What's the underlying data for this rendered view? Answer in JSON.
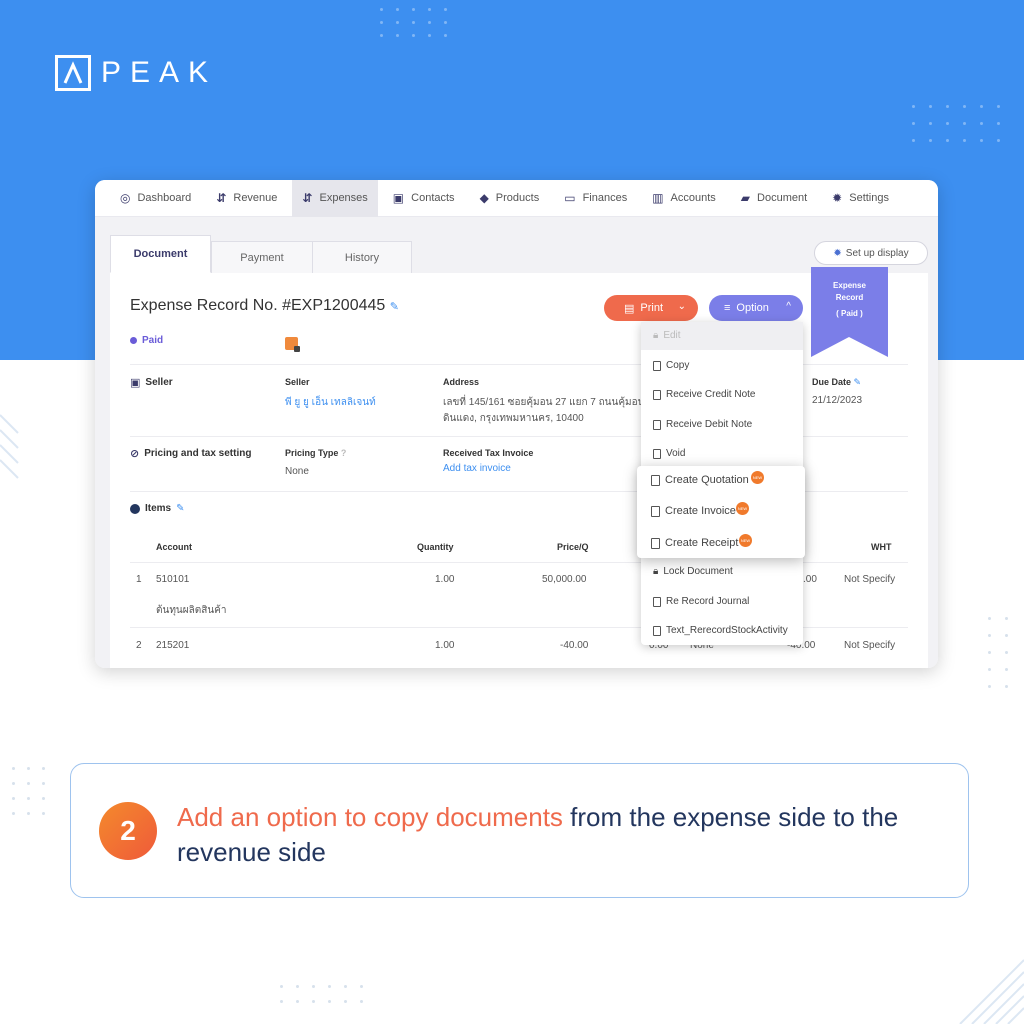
{
  "brand": {
    "name": "PEAK",
    "hero_color": "#3d8ff0",
    "accent_orange": "#ef6a4c",
    "accent_purple": "#7b7ee8"
  },
  "nav": {
    "items": [
      {
        "label": "Dashboard",
        "icon": "dashboard-icon"
      },
      {
        "label": "Revenue",
        "icon": "revenue-icon"
      },
      {
        "label": "Expenses",
        "icon": "expenses-icon",
        "active": true
      },
      {
        "label": "Contacts",
        "icon": "contacts-icon"
      },
      {
        "label": "Products",
        "icon": "products-icon"
      },
      {
        "label": "Finances",
        "icon": "finances-icon"
      },
      {
        "label": "Accounts",
        "icon": "accounts-icon"
      },
      {
        "label": "Document",
        "icon": "folder-icon"
      },
      {
        "label": "Settings",
        "icon": "gear-icon"
      }
    ]
  },
  "tabs": [
    "Document",
    "Payment",
    "History"
  ],
  "setup_display": "Set up display",
  "document": {
    "title": "Expense Record No. #EXP1200445",
    "status": "Paid",
    "ribbon": {
      "line1": "Expense",
      "line2": "Record",
      "line3": "( Paid )"
    },
    "print_label": "Print",
    "option_label": "Option"
  },
  "seller": {
    "section": "Seller",
    "seller_label": "Seller",
    "seller_name": "พี ยู ยู เอ็น เทลลิเจนท์",
    "address_label": "Address",
    "address_line1": "เลขที่ 145/161 ซอยคุ้มอน 27 แยก 7 ถนนคุ้มอน",
    "address_line2": "ดินแดง, กรุงเทพมหานคร, 10400",
    "due_label": "Due Date",
    "due_value": "21/12/2023"
  },
  "pricing": {
    "section": "Pricing and tax setting",
    "type_label": "Pricing Type",
    "type_value": "None",
    "tax_label": "Received Tax Invoice",
    "tax_link": "Add tax invoice"
  },
  "items": {
    "section": "Items",
    "columns": {
      "account": "Account",
      "quantity": "Quantity",
      "price": "Price/Q",
      "wht": "WHT"
    },
    "rows": [
      {
        "no": "1",
        "account": "510101",
        "desc": "ต้นทุนผลิตสินค้า",
        "qty": "1.00",
        "price": "50,000.00",
        "amount": ".00",
        "wht": "Not Specify"
      },
      {
        "no": "2",
        "account": "215201",
        "qty": "1.00",
        "price": "-40.00",
        "disc": "0.00",
        "vat": "None",
        "amount": "-40.00",
        "wht": "Not Specify"
      }
    ]
  },
  "option_menu": {
    "items": [
      "Edit",
      "Copy",
      "Receive Credit Note",
      "Receive Debit Note",
      "Void",
      "Lock Document",
      "Re Record Journal",
      "Text_RerecordStockActivity"
    ]
  },
  "copy_submenu": {
    "items": [
      "Create Quotation",
      "Create Invoice",
      "Create Receipt"
    ],
    "badge": "NEW"
  },
  "callout": {
    "step": "2",
    "highlight": "Add an option to copy documents",
    "rest": "from the expense side to the revenue side"
  }
}
